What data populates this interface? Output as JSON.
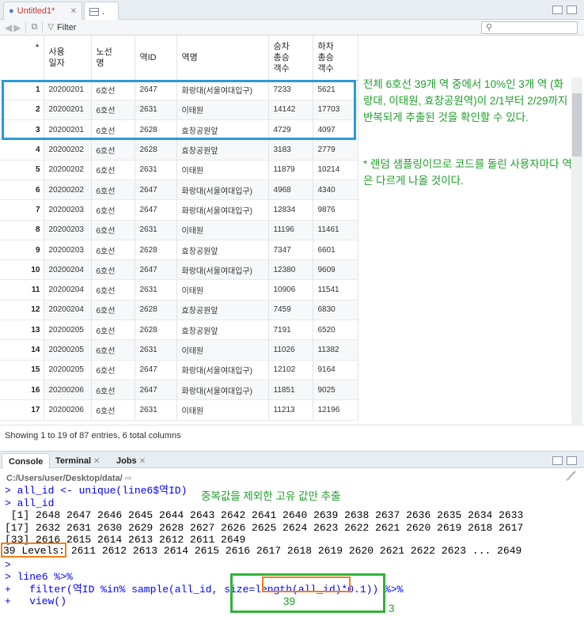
{
  "tabs": {
    "script_tab": "Untitled1*",
    "data_tab": "."
  },
  "toolbar": {
    "filter_label": "Filter"
  },
  "table": {
    "columns": [
      {
        "key": "date",
        "label": "사용\n일자"
      },
      {
        "key": "line",
        "label": "노선\n명"
      },
      {
        "key": "id",
        "label": "역ID"
      },
      {
        "key": "name",
        "label": "역명"
      },
      {
        "key": "on",
        "label": "승차\n총승\n객수"
      },
      {
        "key": "off",
        "label": "하차\n총승\n객수"
      }
    ],
    "rows": [
      [
        "1",
        "20200201",
        "6호선",
        "2647",
        "화랑대(서울여대입구)",
        "7233",
        "5621"
      ],
      [
        "2",
        "20200201",
        "6호선",
        "2631",
        "이태원",
        "14142",
        "17703"
      ],
      [
        "3",
        "20200201",
        "6호선",
        "2628",
        "효창공원앞",
        "4729",
        "4097"
      ],
      [
        "4",
        "20200202",
        "6호선",
        "2628",
        "효창공원앞",
        "3183",
        "2779"
      ],
      [
        "5",
        "20200202",
        "6호선",
        "2631",
        "이태원",
        "11879",
        "10214"
      ],
      [
        "6",
        "20200202",
        "6호선",
        "2647",
        "화랑대(서울여대입구)",
        "4968",
        "4340"
      ],
      [
        "7",
        "20200203",
        "6호선",
        "2647",
        "화랑대(서울여대입구)",
        "12834",
        "9876"
      ],
      [
        "8",
        "20200203",
        "6호선",
        "2631",
        "이태원",
        "11196",
        "11461"
      ],
      [
        "9",
        "20200203",
        "6호선",
        "2628",
        "효창공원앞",
        "7347",
        "6601"
      ],
      [
        "10",
        "20200204",
        "6호선",
        "2647",
        "화랑대(서울여대입구)",
        "12380",
        "9609"
      ],
      [
        "11",
        "20200204",
        "6호선",
        "2631",
        "이태원",
        "10906",
        "11541"
      ],
      [
        "12",
        "20200204",
        "6호선",
        "2628",
        "효창공원앞",
        "7459",
        "6830"
      ],
      [
        "13",
        "20200205",
        "6호선",
        "2628",
        "효창공원앞",
        "7191",
        "6520"
      ],
      [
        "14",
        "20200205",
        "6호선",
        "2631",
        "이태원",
        "11026",
        "11382"
      ],
      [
        "15",
        "20200205",
        "6호선",
        "2647",
        "화랑대(서울여대입구)",
        "12102",
        "9164"
      ],
      [
        "16",
        "20200206",
        "6호선",
        "2647",
        "화랑대(서울여대입구)",
        "11851",
        "9025"
      ],
      [
        "17",
        "20200206",
        "6호선",
        "2631",
        "이태원",
        "11213",
        "12196"
      ]
    ]
  },
  "status": "Showing 1 to 19 of 87 entries, 6 total columns",
  "notes": {
    "note1": "전체 6호선 39개 역 중에서 10%인 3개 역 (화랑대, 이태원, 효창공원역)이 2/1부터 2/29까지 반복되게 추출된 것을 확인할 수 있다.",
    "note2": "* 랜덤 샘플링이므로 코드를 돌린 사용자마다 역은 다르게 나올 것이다.",
    "console_note": "중복값을 제외한 고유 값만 추출",
    "len_value": "39",
    "result_value": "3"
  },
  "console": {
    "tabs": {
      "console": "Console",
      "terminal": "Terminal",
      "jobs": "Jobs"
    },
    "path": "C:/Users/user/Desktop/data/",
    "lines": [
      "> all_id <- unique(line6$역ID)",
      "> all_id",
      " [1] 2648 2647 2646 2645 2644 2643 2642 2641 2640 2639 2638 2637 2636 2635 2634 2633",
      "[17] 2632 2631 2630 2629 2628 2627 2626 2625 2624 2623 2622 2621 2620 2619 2618 2617",
      "[33] 2616 2615 2614 2613 2612 2611 2649",
      "39 Levels: 2611 2612 2613 2614 2615 2616 2617 2618 2619 2620 2621 2622 2623 ... 2649",
      ">",
      "> line6 %>%",
      "+   filter(역ID %in% sample(all_id, size=length(all_id)*0.1)) %>%",
      "+   view()"
    ]
  }
}
